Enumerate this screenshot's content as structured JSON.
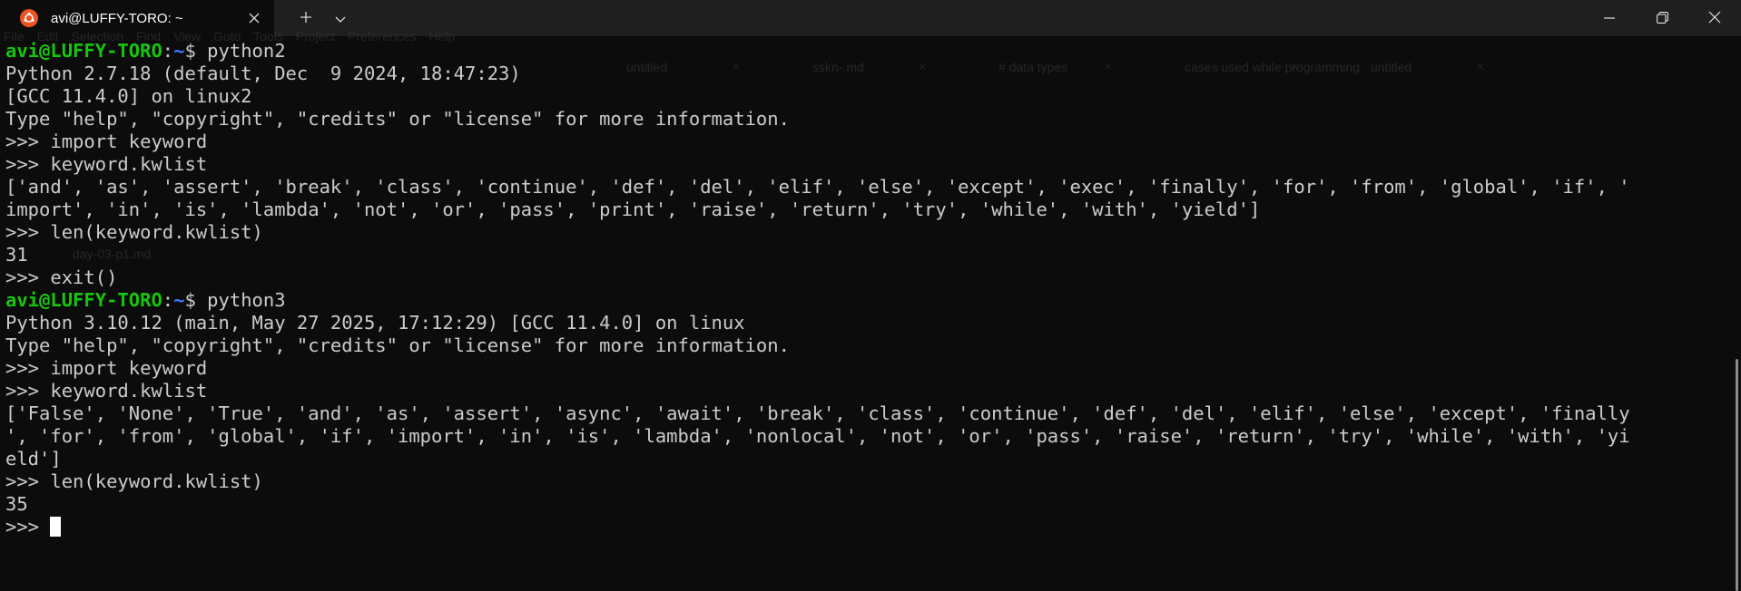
{
  "window": {
    "tab_title": "avi@LUFFY-TORO: ~",
    "icons": {
      "app": "ubuntu-icon",
      "tab_close": "close-icon",
      "new_tab": "plus-icon",
      "dropdown": "chevron-down-icon",
      "minimize": "minimize-icon",
      "restore": "restore-icon",
      "close": "close-icon"
    }
  },
  "background": {
    "menu": "File  Edit  Selection  Find  View  Goto  Tools  Project  Preferences  Help",
    "tabs": [
      "untitled",
      "sskn-.md",
      "# data types",
      "cases used while programming",
      "untitled"
    ],
    "sidebar_file": "day-03-p1.md"
  },
  "colors": {
    "terminal_bg": "#0c0c0c",
    "terminal_fg": "#cccccc",
    "prompt_user": "#16c60c",
    "prompt_path": "#3b78ff",
    "ubuntu_orange": "#e95420"
  },
  "terminal": {
    "lines": [
      {
        "user": "avi@LUFFY-TORO",
        "path": "~",
        "sym": "$ ",
        "cmd": "python2"
      },
      {
        "text": "Python 2.7.18 (default, Dec  9 2024, 18:47:23)"
      },
      {
        "text": "[GCC 11.4.0] on linux2"
      },
      {
        "text": "Type \"help\", \"copyright\", \"credits\" or \"license\" for more information."
      },
      {
        "text": ">>> import keyword"
      },
      {
        "text": ">>> keyword.kwlist"
      },
      {
        "text": "['and', 'as', 'assert', 'break', 'class', 'continue', 'def', 'del', 'elif', 'else', 'except', 'exec', 'finally', 'for', 'from', 'global', 'if', '"
      },
      {
        "text": "import', 'in', 'is', 'lambda', 'not', 'or', 'pass', 'print', 'raise', 'return', 'try', 'while', 'with', 'yield']"
      },
      {
        "text": ">>> len(keyword.kwlist)"
      },
      {
        "text": "31"
      },
      {
        "text": ">>> exit()"
      },
      {
        "user": "avi@LUFFY-TORO",
        "path": "~",
        "sym": "$ ",
        "cmd": "python3"
      },
      {
        "text": "Python 3.10.12 (main, May 27 2025, 17:12:29) [GCC 11.4.0] on linux"
      },
      {
        "text": "Type \"help\", \"copyright\", \"credits\" or \"license\" for more information."
      },
      {
        "text": ">>> import keyword"
      },
      {
        "text": ">>> keyword.kwlist"
      },
      {
        "text": "['False', 'None', 'True', 'and', 'as', 'assert', 'async', 'await', 'break', 'class', 'continue', 'def', 'del', 'elif', 'else', 'except', 'finally"
      },
      {
        "text": "', 'for', 'from', 'global', 'if', 'import', 'in', 'is', 'lambda', 'nonlocal', 'not', 'or', 'pass', 'raise', 'return', 'try', 'while', 'with', 'yi"
      },
      {
        "text": "eld']"
      },
      {
        "text": ">>> len(keyword.kwlist)"
      },
      {
        "text": "35"
      },
      {
        "text": ">>> ",
        "cursor": true
      }
    ]
  }
}
